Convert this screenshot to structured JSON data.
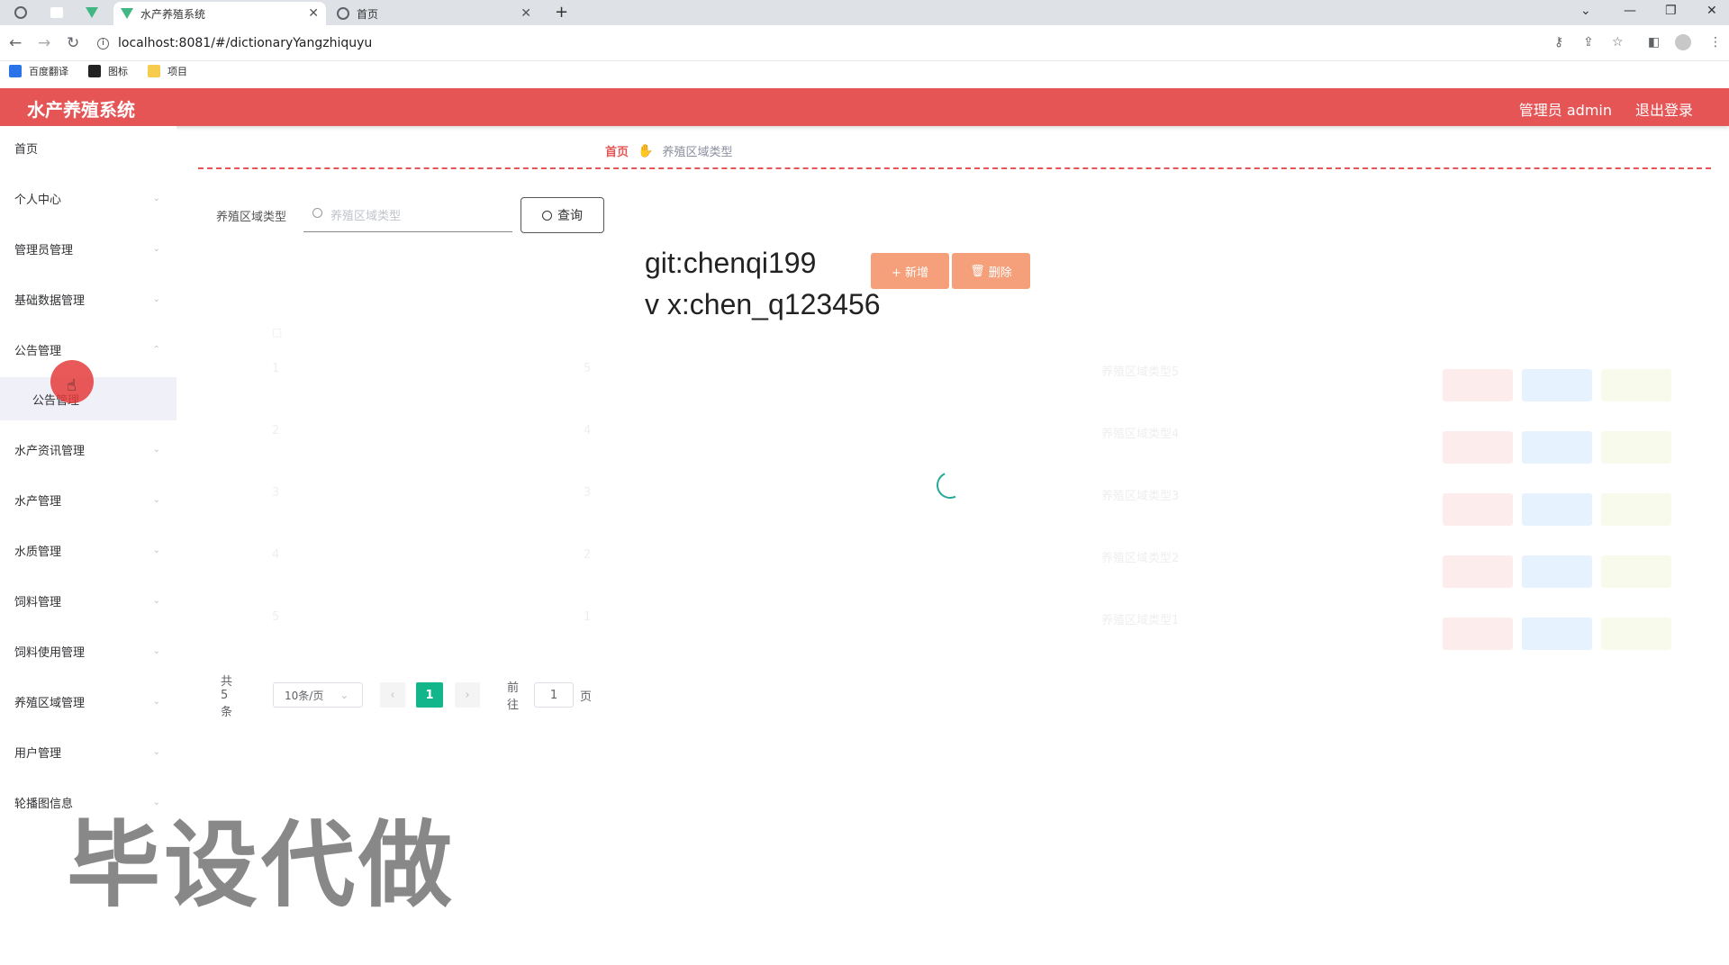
{
  "browser": {
    "tabs": [
      {
        "title": "水产养殖系统",
        "active": true
      },
      {
        "title": "首页",
        "active": false
      }
    ],
    "new_tab": "+",
    "url": "localhost:8081/#/dictionaryYangzhiquyu",
    "bookmarks": [
      "百度翻译",
      "图标",
      "项目"
    ]
  },
  "header": {
    "title": "水产养殖系统",
    "user": "管理员 admin",
    "logout": "退出登录",
    "color": "#e55556"
  },
  "sidebar": {
    "items": [
      {
        "label": "首页"
      },
      {
        "label": "个人中心"
      },
      {
        "label": "管理员管理"
      },
      {
        "label": "基础数据管理"
      },
      {
        "label": "公告管理"
      },
      {
        "label": "公告管理",
        "sub": true,
        "active": true
      },
      {
        "label": "水产资讯管理"
      },
      {
        "label": "水产管理"
      },
      {
        "label": "水质管理"
      },
      {
        "label": "饲料管理"
      },
      {
        "label": "饲料使用管理"
      },
      {
        "label": "养殖区域管理"
      },
      {
        "label": "用户管理"
      },
      {
        "label": "轮播图信息"
      }
    ]
  },
  "breadcrumb": {
    "home": "首页",
    "current": "养殖区域类型"
  },
  "search": {
    "label": "养殖区域类型",
    "placeholder": "养殖区域类型",
    "button": "查询"
  },
  "overlay": {
    "line1": "git:chenqi199",
    "line2": "v x:chen_q123456"
  },
  "actions": {
    "add": "+ 新增",
    "delete": "删除"
  },
  "table": {
    "rows": [
      {
        "idx": "1",
        "code": "5",
        "name": "养殖区域类型5"
      },
      {
        "idx": "2",
        "code": "4",
        "name": "养殖区域类型4"
      },
      {
        "idx": "3",
        "code": "3",
        "name": "养殖区域类型3"
      },
      {
        "idx": "4",
        "code": "2",
        "name": "养殖区域类型2"
      },
      {
        "idx": "5",
        "code": "1",
        "name": "养殖区域类型1"
      }
    ]
  },
  "pagination": {
    "total": "共 5 条",
    "page_size": "10条/页",
    "current": "1",
    "goto_prefix": "前往",
    "goto_value": "1",
    "goto_suffix": "页"
  },
  "watermark": "毕设代做"
}
